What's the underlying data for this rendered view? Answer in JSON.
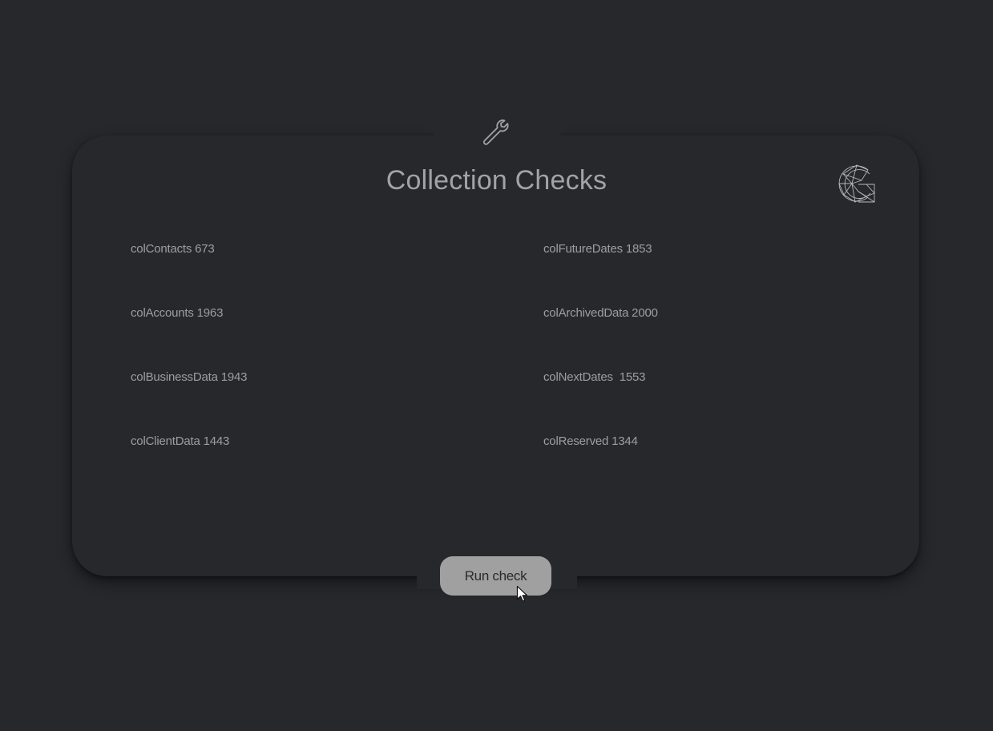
{
  "header": {
    "title": "Collection Checks",
    "top_icon": "wrench-icon",
    "logo_icon": "geometric-g-logo"
  },
  "collections": {
    "left": [
      "colContacts 673",
      "colAccounts 1963",
      "colBusinessData 1943",
      "colClientData 1443"
    ],
    "right": [
      "colFutureDates 1853",
      "colArchivedData 2000",
      "colNextDates  1553",
      "colReserved 1344"
    ]
  },
  "actions": {
    "run_label": "Run check"
  },
  "colors": {
    "background": "#27282c",
    "text": "#9d9ea1",
    "title": "#a3a3a6",
    "button": "#a0a0a0"
  }
}
